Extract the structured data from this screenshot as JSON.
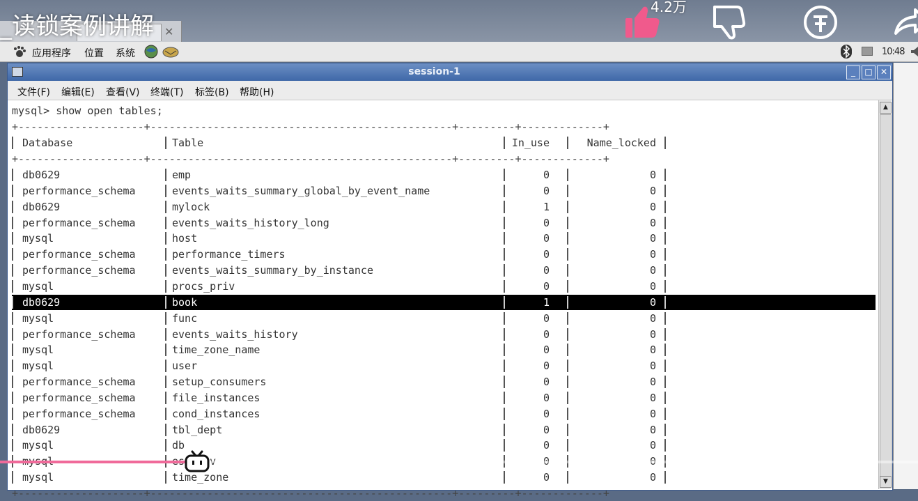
{
  "video": {
    "title": "_读锁案例讲解",
    "like_count": "4.2万"
  },
  "panel": {
    "menus": [
      "应用程序",
      "位置",
      "系统"
    ],
    "clock": "10:48"
  },
  "window": {
    "title": "session-1",
    "menu": [
      "文件(F)",
      "编辑(E)",
      "查看(V)",
      "终端(T)",
      "标签(B)",
      "帮助(H)"
    ]
  },
  "terminal": {
    "prompt": "mysql> show open tables;",
    "border": "+--------------------+------------------------------------------------+---------+-------------+",
    "headers": [
      "Database",
      "Table",
      "In_use",
      "Name_locked"
    ],
    "rows": [
      {
        "db": "db0629",
        "table": "emp",
        "in_use": "0",
        "name_locked": "0"
      },
      {
        "db": "performance_schema",
        "table": "events_waits_summary_global_by_event_name",
        "in_use": "0",
        "name_locked": "0"
      },
      {
        "db": "db0629",
        "table": "mylock",
        "in_use": "1",
        "name_locked": "0"
      },
      {
        "db": "performance_schema",
        "table": "events_waits_history_long",
        "in_use": "0",
        "name_locked": "0"
      },
      {
        "db": "mysql",
        "table": "host",
        "in_use": "0",
        "name_locked": "0"
      },
      {
        "db": "performance_schema",
        "table": "performance_timers",
        "in_use": "0",
        "name_locked": "0"
      },
      {
        "db": "performance_schema",
        "table": "events_waits_summary_by_instance",
        "in_use": "0",
        "name_locked": "0"
      },
      {
        "db": "mysql",
        "table": "procs_priv",
        "in_use": "0",
        "name_locked": "0"
      },
      {
        "db": "db0629",
        "table": "book",
        "in_use": "1",
        "name_locked": "0",
        "selected": true
      },
      {
        "db": "mysql",
        "table": "func",
        "in_use": "0",
        "name_locked": "0"
      },
      {
        "db": "performance_schema",
        "table": "events_waits_history",
        "in_use": "0",
        "name_locked": "0"
      },
      {
        "db": "mysql",
        "table": "time_zone_name",
        "in_use": "0",
        "name_locked": "0"
      },
      {
        "db": "mysql",
        "table": "user",
        "in_use": "0",
        "name_locked": "0"
      },
      {
        "db": "performance_schema",
        "table": "setup_consumers",
        "in_use": "0",
        "name_locked": "0"
      },
      {
        "db": "performance_schema",
        "table": "file_instances",
        "in_use": "0",
        "name_locked": "0"
      },
      {
        "db": "performance_schema",
        "table": "cond_instances",
        "in_use": "0",
        "name_locked": "0"
      },
      {
        "db": "db0629",
        "table": "tbl_dept",
        "in_use": "0",
        "name_locked": "0"
      },
      {
        "db": "mysql",
        "table": "db",
        "in_use": "0",
        "name_locked": "0"
      },
      {
        "db": "mysql",
        "table": "es_priv",
        "in_use": "0",
        "name_locked": "0"
      },
      {
        "db": "mysql",
        "table": "time_zone",
        "in_use": "0",
        "name_locked": "0"
      }
    ]
  },
  "player": {
    "progress": 0.21
  },
  "colors": {
    "titlebar": "#3f68a8",
    "selection": "#000000",
    "like_pink": "#f05a8c",
    "progress": "#f06a9a"
  }
}
